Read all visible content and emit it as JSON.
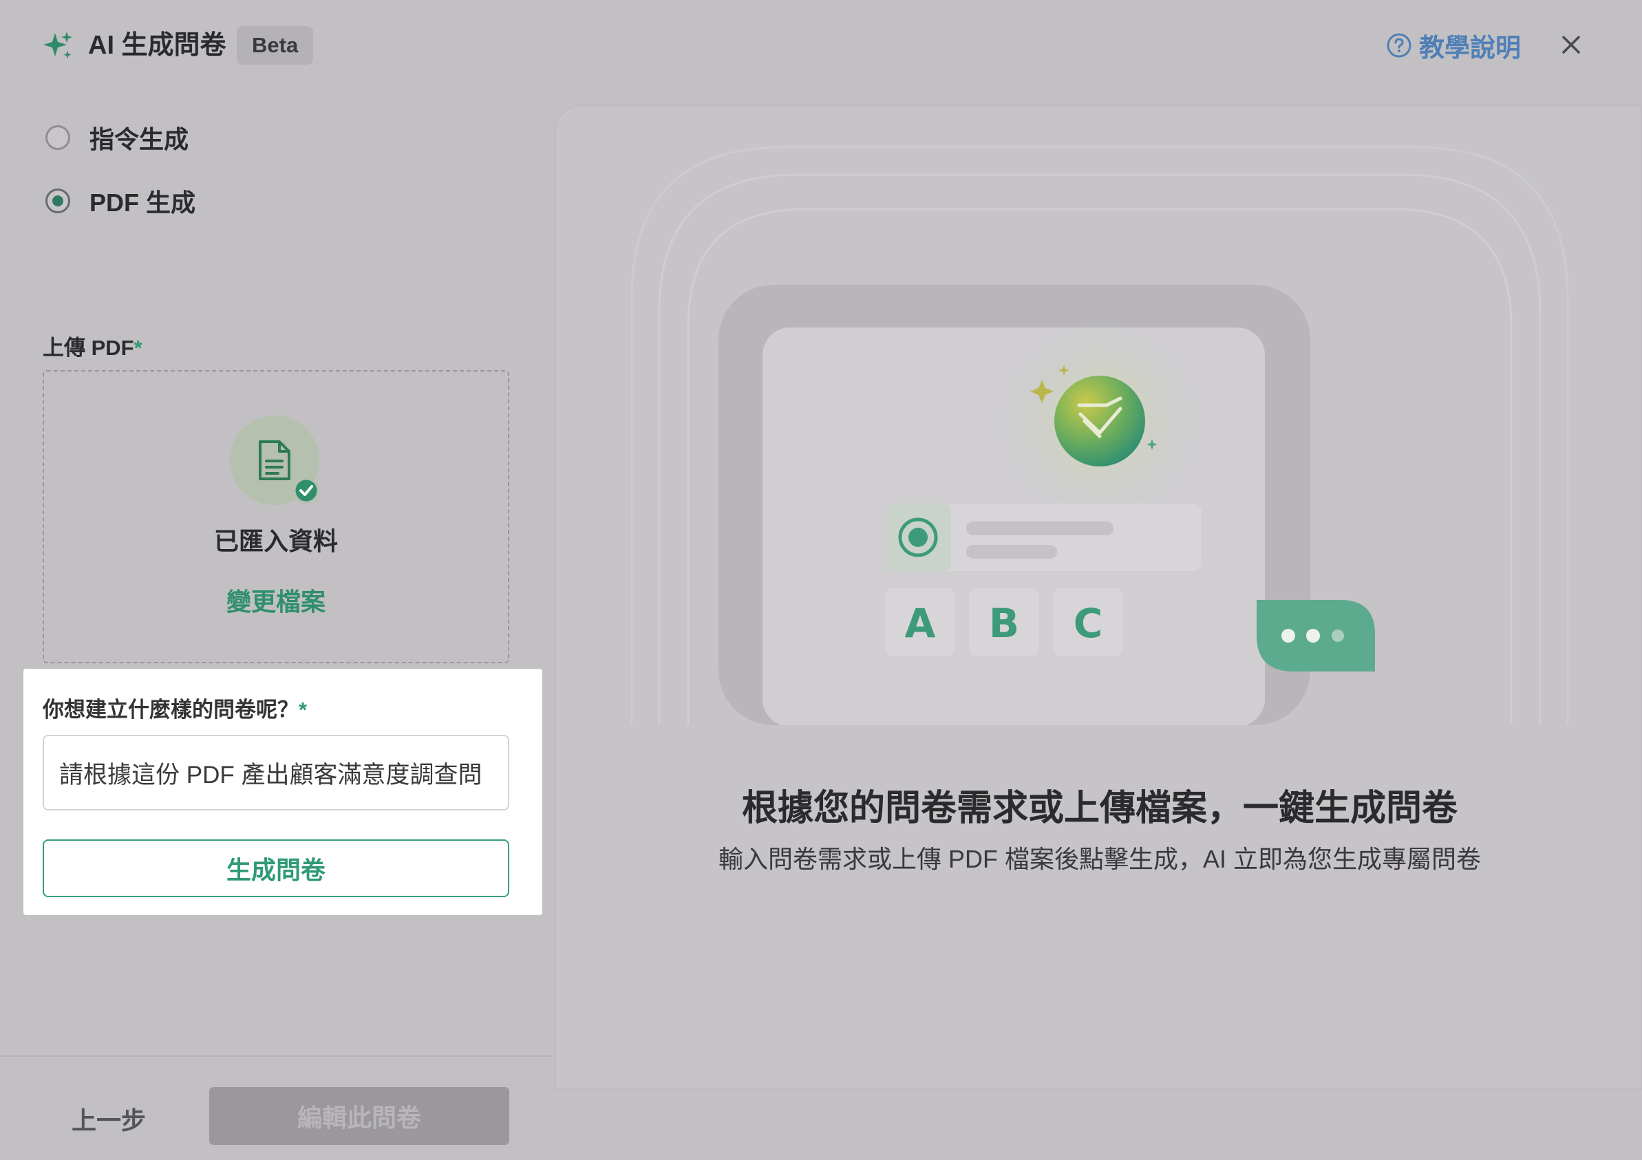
{
  "header": {
    "title": "AI 生成問卷",
    "beta_badge": "Beta",
    "help_label": "教學說明"
  },
  "mode_options": [
    {
      "label": "指令生成",
      "selected": false
    },
    {
      "label": "PDF 生成",
      "selected": true
    }
  ],
  "upload": {
    "label": "上傳 PDF",
    "required_mark": "*",
    "status": "已匯入資料",
    "change_file_link": "變更檔案"
  },
  "prompt": {
    "label": "你想建立什麼樣的問卷呢？",
    "required_mark": "*",
    "value": "請根據這份 PDF 產出顧客滿意度調查問",
    "generate_button": "生成問卷"
  },
  "footer": {
    "prev_button": "上一步",
    "edit_button": "編輯此問卷"
  },
  "preview": {
    "option_letters": [
      "A",
      "B",
      "C"
    ],
    "headline": "根據您的問卷需求或上傳檔案，一鍵生成問卷",
    "subline": "輸入問卷需求或上傳 PDF 檔案後點擊生成，AI 立即為您生成專屬問卷"
  },
  "colors": {
    "accent": "#2f9a74",
    "help_link": "#4f7fb6",
    "overlay_background": "#c2c0c3"
  }
}
